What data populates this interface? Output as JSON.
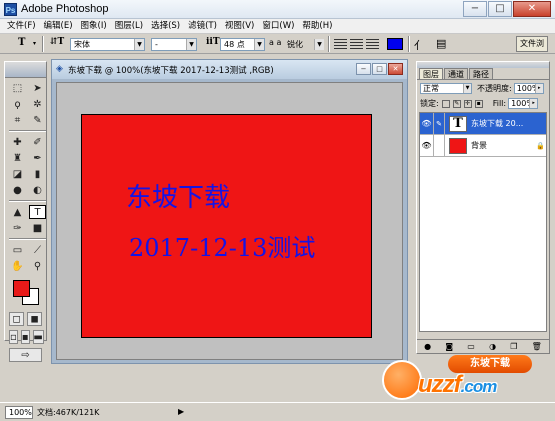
{
  "window": {
    "title": "Adobe Photoshop",
    "minimize": "−",
    "restore": "□",
    "close": "✕"
  },
  "menu": [
    "文件(F)",
    "编辑(E)",
    "图象(I)",
    "图层(L)",
    "选择(S)",
    "滤镜(T)",
    "视图(V)",
    "窗口(W)",
    "帮助(H)"
  ],
  "options": {
    "tool_icon": "T",
    "font_family": "宋体",
    "font_style": "-",
    "font_size": "48 点",
    "aa_label": "a a",
    "antialias": "锐化",
    "text_color": "#0000ee",
    "palette_tab": "文件浏"
  },
  "document": {
    "title": "东坡下载 @ 100%(东坡下载 2017-12-13测试 ,RGB)",
    "canvas_color": "#ef1515",
    "text_color": "#1414e6",
    "text_line1": "东坡下载",
    "text_line2": "2017-12-13测试"
  },
  "toolbox": {
    "fg_color": "#e81a19",
    "bg_color": "#ffffff"
  },
  "layers_panel": {
    "tabs": [
      "图层",
      "通道",
      "路径"
    ],
    "blend_mode": "正常",
    "opacity_label": "不透明度:",
    "opacity_value": "100%",
    "lock_label": "锁定:",
    "fill_label": "Fill:",
    "fill_value": "100%",
    "layers": [
      {
        "name": "东坡下载 20...",
        "thumb": "T",
        "selected": true
      },
      {
        "name": "背景",
        "thumb": "",
        "selected": false
      }
    ]
  },
  "status": {
    "zoom": "100%",
    "doc_size": "文档:467K/121K"
  },
  "watermark": {
    "banner": "东坡下载",
    "text_main": "uzzf",
    "text_suffix": ".com"
  }
}
